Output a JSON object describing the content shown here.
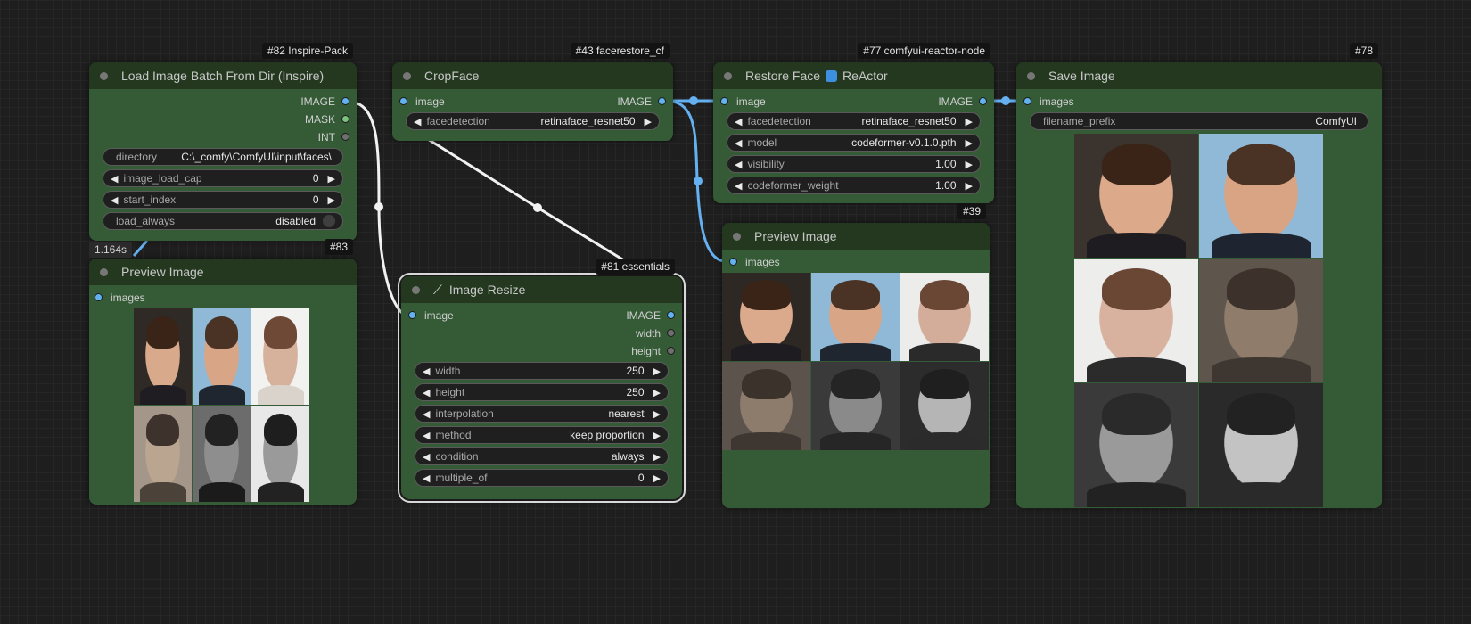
{
  "nodes": {
    "load_batch": {
      "badge": "#82 Inspire-Pack",
      "title": "Load Image Batch From Dir (Inspire)",
      "outputs": [
        "IMAGE",
        "MASK",
        "INT"
      ],
      "directory": {
        "label": "directory",
        "value": "C:\\_comfy\\ComfyUI\\input\\faces\\"
      },
      "image_load_cap": {
        "label": "image_load_cap",
        "value": "0"
      },
      "start_index": {
        "label": "start_index",
        "value": "0"
      },
      "load_always": {
        "label": "load_always",
        "value": "disabled"
      },
      "timer": "1.164s"
    },
    "preview83": {
      "badge": "#83",
      "title": "Preview Image",
      "input": "images"
    },
    "cropface": {
      "badge": "#43 facerestore_cf",
      "title": "CropFace",
      "input": "image",
      "output": "IMAGE",
      "facedetection": {
        "label": "facedetection",
        "value": "retinaface_resnet50"
      }
    },
    "image_resize": {
      "badge": "#81 essentials",
      "title": "Image Resize",
      "input": "image",
      "outputs": [
        "IMAGE",
        "width",
        "height"
      ],
      "widgets": [
        {
          "label": "width",
          "value": "250"
        },
        {
          "label": "height",
          "value": "250"
        },
        {
          "label": "interpolation",
          "value": "nearest"
        },
        {
          "label": "method",
          "value": "keep proportion"
        },
        {
          "label": "condition",
          "value": "always"
        },
        {
          "label": "multiple_of",
          "value": "0"
        }
      ]
    },
    "restore_face": {
      "badge": "#77 comfyui-reactor-node",
      "title_left": "Restore Face",
      "title_right": "ReActor",
      "input": "image",
      "output": "IMAGE",
      "widgets": [
        {
          "label": "facedetection",
          "value": "retinaface_resnet50"
        },
        {
          "label": "model",
          "value": "codeformer-v0.1.0.pth"
        },
        {
          "label": "visibility",
          "value": "1.00"
        },
        {
          "label": "codeformer_weight",
          "value": "1.00"
        }
      ]
    },
    "preview39": {
      "badge": "#39",
      "title": "Preview Image",
      "input": "images"
    },
    "save_image": {
      "badge": "#78",
      "title": "Save Image",
      "input": "images",
      "filename_prefix": {
        "label": "filename_prefix",
        "value": "ComfyUI"
      }
    }
  },
  "colors": {
    "node_body": "#355b36",
    "node_header": "#23381f",
    "image_socket": "#62b2f1",
    "mask_socket": "#7ec07e",
    "int_socket": "#6f6f6f",
    "wire_image": "#64b0f0",
    "wire_white": "#f2f2f2"
  },
  "icons": {
    "node_status": "circle-dot-icon",
    "widget_left": "triangle-left-icon",
    "widget_right": "triangle-right-icon",
    "reactor_badge": "shield-icon",
    "wand": "magic-wand-icon"
  },
  "thumbnails": {
    "preview83": [
      {
        "bg": "#2f2a26",
        "skin": "#d9a98b",
        "hair": "#3a2418",
        "cloth": "#201d22"
      },
      {
        "bg": "#8fb9d6",
        "skin": "#d8a586",
        "hair": "#4a3324",
        "cloth": "#202630"
      },
      {
        "bg": "#f2f2f0",
        "skin": "#d6b19c",
        "hair": "#6e4a36",
        "cloth": "#d9d3cb"
      },
      {
        "bg": "#a5968a",
        "skin": "#b9a590",
        "hair": "#3d332c",
        "cloth": "#4b423a"
      },
      {
        "bg": "#6c6c6c",
        "skin": "#8e8e8e",
        "hair": "#222222",
        "cloth": "#1b1b1b"
      },
      {
        "bg": "#e8e8e8",
        "skin": "#9a9a9a",
        "hair": "#1e1e1e",
        "cloth": "#222222"
      }
    ],
    "preview39": [
      {
        "bg": "#2d2824",
        "skin": "#dba98b",
        "hair": "#3a2418",
        "cloth": "#1f1c21"
      },
      {
        "bg": "#8fb9d6",
        "skin": "#d8a586",
        "hair": "#4a3324",
        "cloth": "#202630"
      },
      {
        "bg": "#ececea",
        "skin": "#d3ad99",
        "hair": "#6a4634",
        "cloth": "#2a2a2a"
      },
      {
        "bg": "#5b534c",
        "skin": "#8d7b6c",
        "hair": "#3b322c",
        "cloth": "#3e3630"
      },
      {
        "bg": "#3a3a3a",
        "skin": "#8a8a8a",
        "hair": "#252525",
        "cloth": "#262626"
      },
      {
        "bg": "#2c2c2c",
        "skin": "#b5b5b5",
        "hair": "#1f1f1f",
        "cloth": "#2b2b2b"
      }
    ],
    "save78": [
      {
        "bg": "#3a332e",
        "skin": "#dca98b",
        "hair": "#3a2418",
        "cloth": "#1f1c21"
      },
      {
        "bg": "#8fb9d6",
        "skin": "#d9a484",
        "hair": "#4a3324",
        "cloth": "#1f2530"
      },
      {
        "bg": "#ededec",
        "skin": "#d8b29f",
        "hair": "#6a4634",
        "cloth": "#2b2b2b"
      },
      {
        "bg": "#5e554d",
        "skin": "#8f7c6b",
        "hair": "#3c322b",
        "cloth": "#3e3630"
      },
      {
        "bg": "#3a3a3a",
        "skin": "#9a9a9a",
        "hair": "#2a2a2a",
        "cloth": "#222222"
      },
      {
        "bg": "#2a2a2a",
        "skin": "#c3c3c3",
        "hair": "#222222",
        "cloth": "#2a2a2a"
      }
    ]
  }
}
